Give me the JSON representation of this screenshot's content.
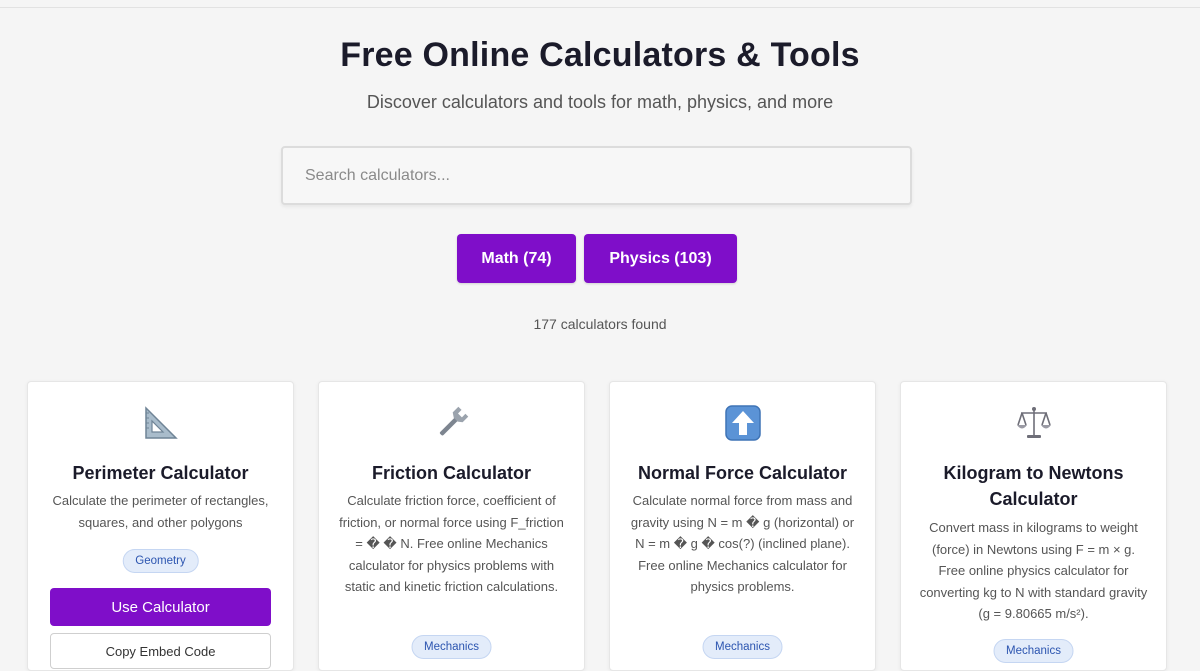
{
  "header": {
    "title": "Free Online Calculators & Tools",
    "subtitle": "Discover calculators and tools for math, physics, and more"
  },
  "search": {
    "placeholder": "Search calculators...",
    "value": ""
  },
  "categories": [
    {
      "label": "Math (74)"
    },
    {
      "label": "Physics (103)"
    }
  ],
  "results": {
    "count_text": "177 calculators found"
  },
  "colors": {
    "accent": "#7f0ec9",
    "tag_bg": "#e3ecfa",
    "tag_text": "#2c55b0"
  },
  "cards": [
    {
      "icon": "set-square-icon",
      "title": "Perimeter Calculator",
      "description": "Calculate the perimeter of rectangles, squares, and other polygons",
      "tag": "Geometry",
      "use_label": "Use Calculator",
      "embed_label": "Copy Embed Code"
    },
    {
      "icon": "wrench-icon",
      "title": "Friction Calculator",
      "description": "Calculate friction force, coefficient of friction, or normal force using F_friction = � � N. Free online Mechanics calculator for physics problems with static and kinetic friction calculations.",
      "tag": "Mechanics"
    },
    {
      "icon": "up-arrow-icon",
      "title": "Normal Force Calculator",
      "description": "Calculate normal force from mass and gravity using N = m � g (horizontal) or N = m � g � cos(?) (inclined plane). Free online Mechanics calculator for physics problems.",
      "tag": "Mechanics"
    },
    {
      "icon": "scales-icon",
      "title": "Kilogram to Newtons Calculator",
      "description": "Convert mass in kilograms to weight (force) in Newtons using F = m × g. Free online physics calculator for converting kg to N with standard gravity (g = 9.80665 m/s²).",
      "tag": "Mechanics"
    }
  ]
}
